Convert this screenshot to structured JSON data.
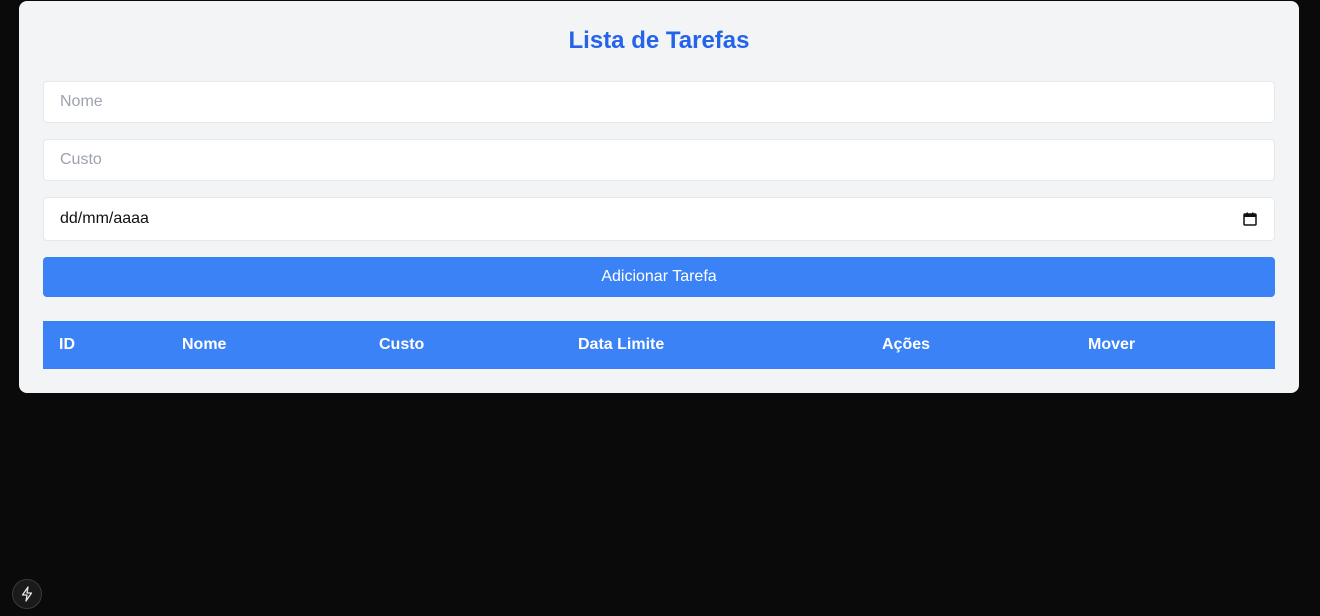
{
  "header": {
    "title": "Lista de Tarefas"
  },
  "form": {
    "nome_placeholder": "Nome",
    "custo_placeholder": "Custo",
    "date_value": "dd/mm/aaaa",
    "date_icon": "calendar-icon",
    "add_button_label": "Adicionar Tarefa"
  },
  "table": {
    "columns": [
      "ID",
      "Nome",
      "Custo",
      "Data Limite",
      "Ações",
      "Mover"
    ],
    "rows": []
  },
  "dev_indicator": {
    "icon": "lightning-bolt-icon"
  },
  "colors": {
    "page_background": "#0a0a0a",
    "card_background": "#f3f4f6",
    "accent": "#3b82f6",
    "title": "#2563eb"
  }
}
